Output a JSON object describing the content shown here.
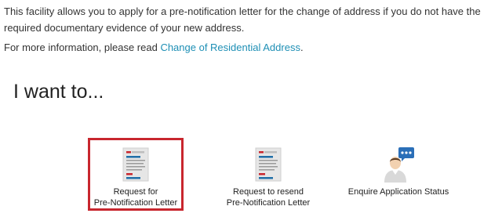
{
  "intro": {
    "text": "This facility allows you to apply for a pre-notification letter for the change of address if you do not have the required documentary evidence of your new address.",
    "more_prefix": "For more information, please read ",
    "more_link": "Change of Residential Address",
    "more_suffix": "."
  },
  "section": {
    "heading": "I want to..."
  },
  "options": [
    {
      "label": "Request for\nPre-Notification Letter",
      "icon": "document-icon",
      "selected": true
    },
    {
      "label": "Request to resend\nPre-Notification Letter",
      "icon": "document-icon",
      "selected": false
    },
    {
      "label": "Enquire Application Status",
      "icon": "person-chat-icon",
      "selected": false
    }
  ],
  "colors": {
    "link": "#1e8fb5",
    "selection_border": "#c8262e",
    "doc_red": "#c8262e",
    "doc_blue": "#1f6fa8",
    "chat_blue": "#2b6fb8"
  }
}
